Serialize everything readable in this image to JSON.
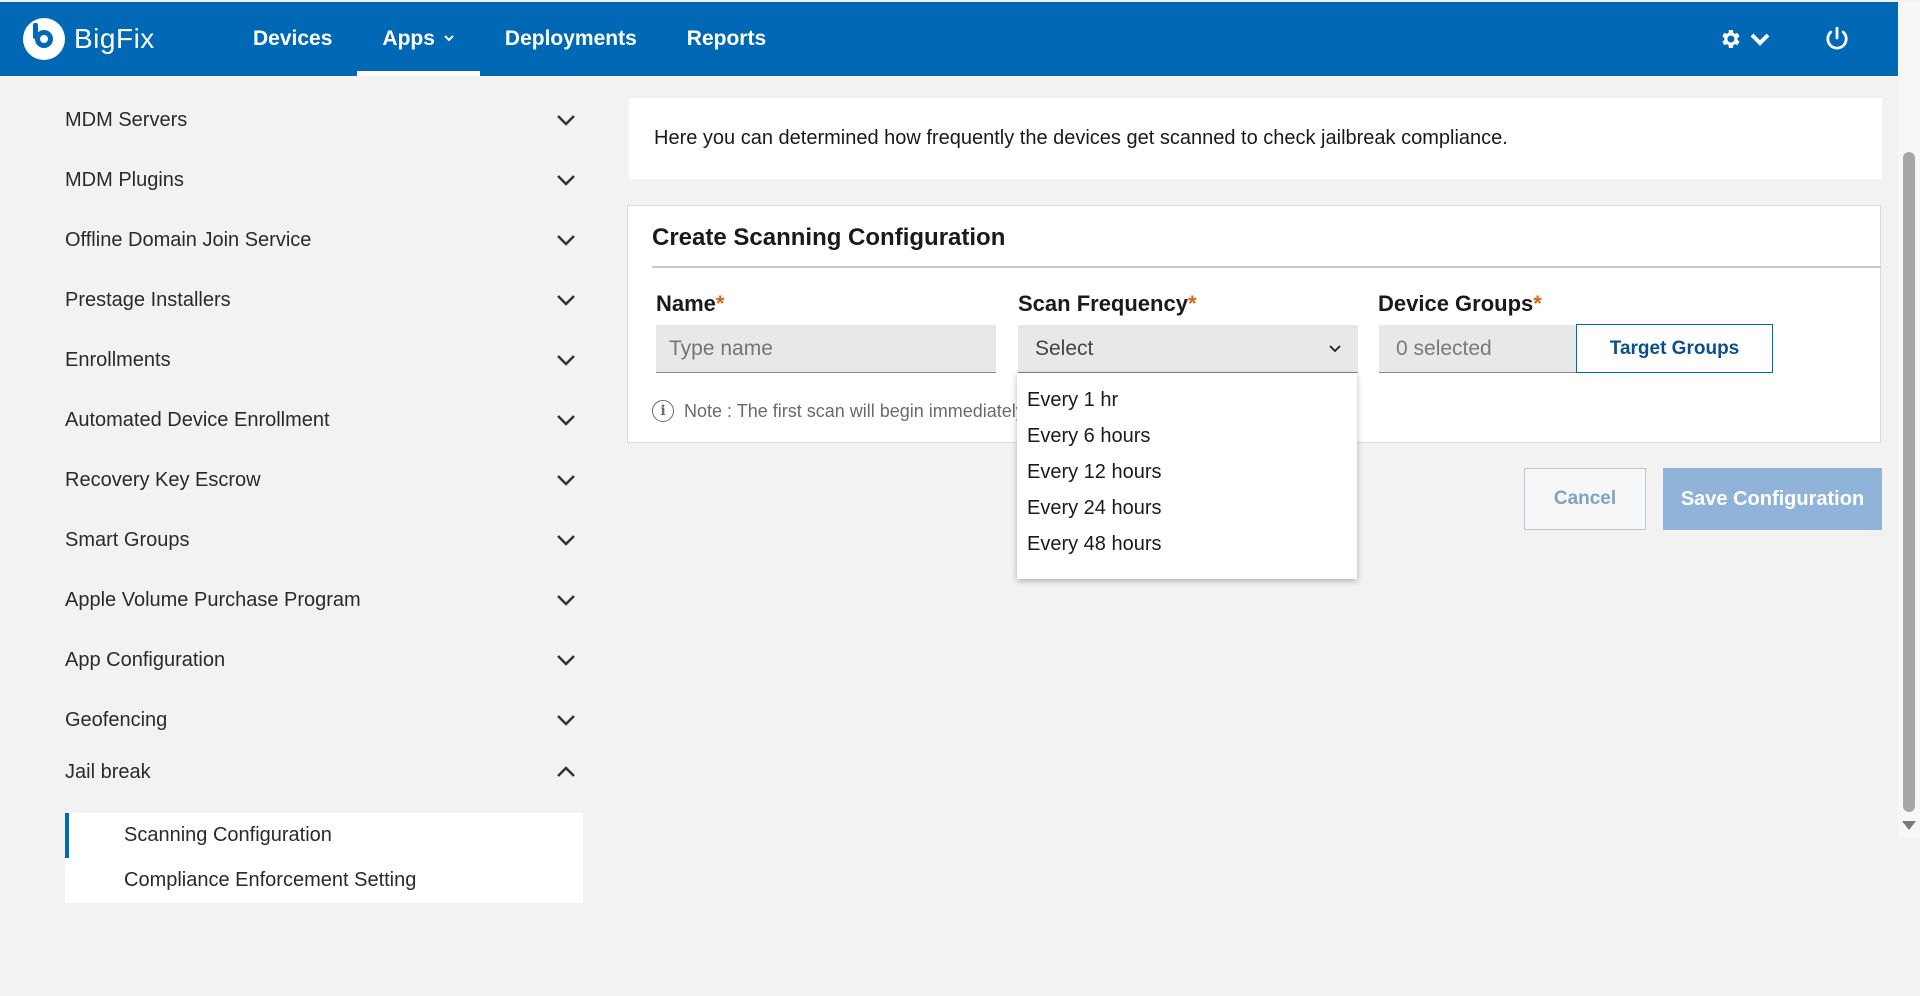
{
  "app": {
    "logo_text": "BigFix"
  },
  "nav": {
    "items": [
      {
        "label": "Devices"
      },
      {
        "label": "Apps"
      },
      {
        "label": "Deployments"
      },
      {
        "label": "Reports"
      }
    ],
    "active": "Apps"
  },
  "sidebar": {
    "items": [
      {
        "label": "MDM Servers"
      },
      {
        "label": "MDM Plugins"
      },
      {
        "label": "Offline Domain Join Service"
      },
      {
        "label": "Prestage Installers"
      },
      {
        "label": "Enrollments"
      },
      {
        "label": "Automated Device Enrollment"
      },
      {
        "label": "Recovery Key Escrow"
      },
      {
        "label": "Smart Groups"
      },
      {
        "label": "Apple Volume Purchase Program"
      },
      {
        "label": "App Configuration"
      },
      {
        "label": "Geofencing"
      }
    ],
    "open_section": {
      "label": "Jail break",
      "children": [
        {
          "label": "Scanning Configuration",
          "selected": true
        },
        {
          "label": "Compliance Enforcement Setting",
          "selected": false
        }
      ]
    }
  },
  "info": {
    "text": "Here you can determined how frequently the devices get scanned to check jailbreak compliance."
  },
  "form": {
    "title": "Create Scanning Configuration",
    "required_mark": "*",
    "name": {
      "label": "Name",
      "placeholder": "Type name"
    },
    "frequency": {
      "label": "Scan Frequency",
      "value": "Select",
      "options": [
        "Every 1 hr",
        "Every 6 hours",
        "Every 12 hours",
        "Every 24 hours",
        "Every 48 hours"
      ]
    },
    "groups": {
      "label": "Device Groups",
      "value": "0 selected",
      "button": "Target Groups"
    },
    "note": "Note : The first scan will begin immediately"
  },
  "actions": {
    "cancel": "Cancel",
    "save": "Save Configuration"
  },
  "colors": {
    "brand": "#0068b5",
    "required": "#d9631a",
    "save_disabled": "#8fb3d9"
  }
}
